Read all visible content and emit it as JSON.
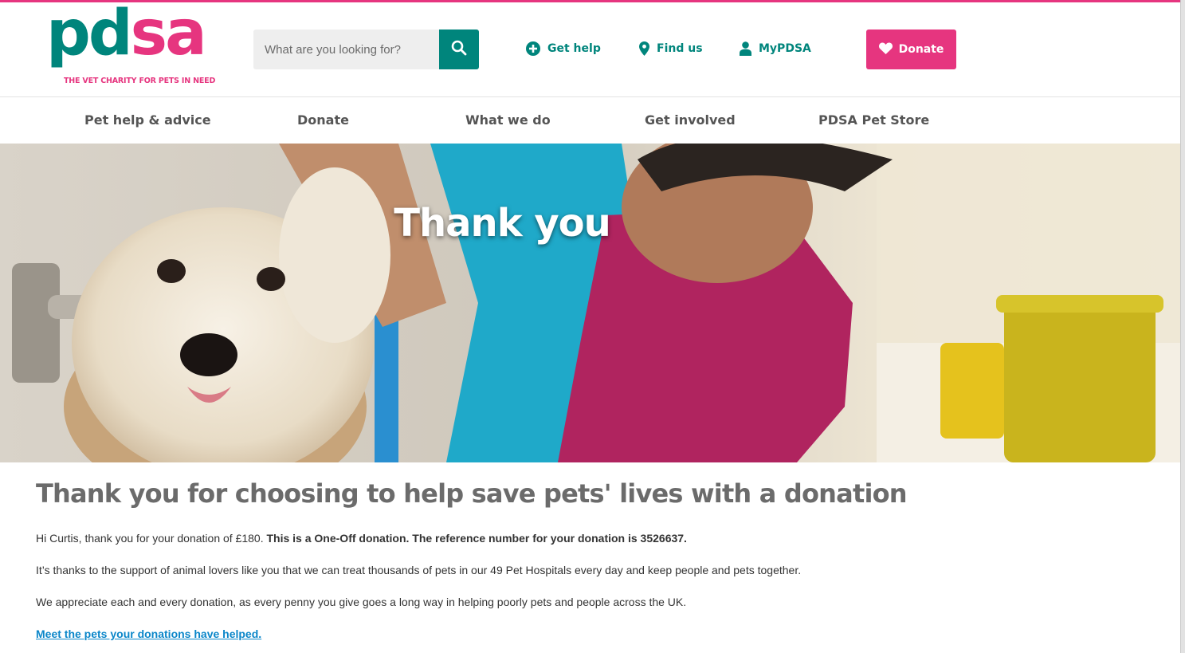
{
  "colors": {
    "brand_teal": "#00857c",
    "brand_pink": "#e6357f",
    "heading_grey": "#6b6b6b",
    "link_blue": "#0a86c9"
  },
  "logo": {
    "word_pd": "pd",
    "word_sa": "sa",
    "tagline": "THE VET CHARITY FOR PETS IN NEED"
  },
  "search": {
    "placeholder": "What are you looking for?",
    "value": "",
    "icon": "search-icon"
  },
  "utility_nav": [
    {
      "label": "Get help",
      "icon": "plus-circle-icon"
    },
    {
      "label": "Find us",
      "icon": "map-pin-icon"
    },
    {
      "label": "MyPDSA",
      "icon": "user-icon"
    }
  ],
  "donate_button": {
    "label": "Donate",
    "icon": "heart-icon"
  },
  "main_nav": [
    {
      "label": "Pet help & advice"
    },
    {
      "label": "Donate"
    },
    {
      "label": "What we do"
    },
    {
      "label": "Get involved"
    },
    {
      "label": "PDSA Pet Store"
    }
  ],
  "hero": {
    "title": "Thank you"
  },
  "content": {
    "heading": "Thank you for choosing to help save pets' lives with a donation",
    "p1_plain": "Hi Curtis, thank you for your donation of £180. ",
    "p1_bold": "This is a One-Off donation. The reference number for your donation is 3526637.",
    "p2": "It’s thanks to the support of animal lovers like you that we can treat thousands of pets in our 49 Pet Hospitals every day and keep people and pets together.",
    "p3": "We appreciate each and every donation, as every penny you give goes a long way in helping poorly pets and people across the UK.",
    "link": "Meet the pets your donations have helped."
  }
}
